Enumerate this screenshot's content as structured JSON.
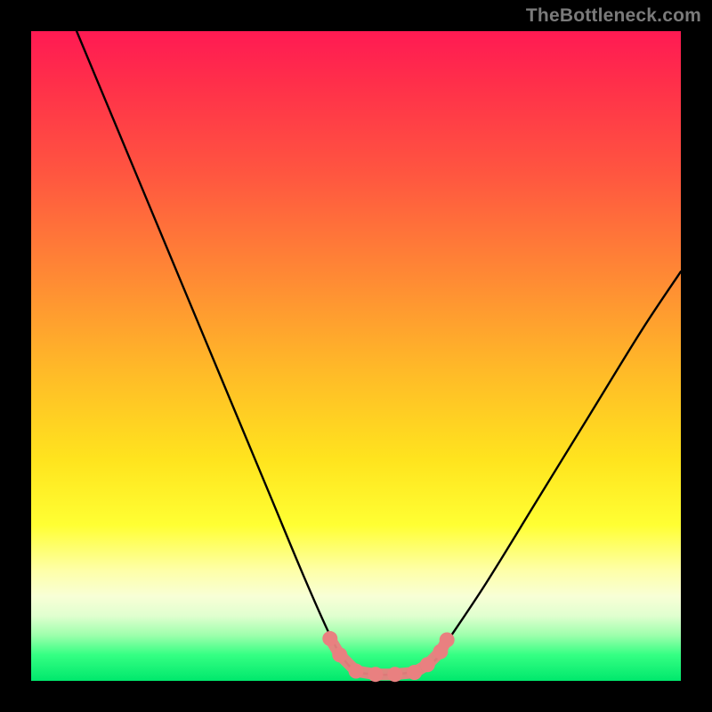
{
  "watermark": "TheBottleneck.com",
  "chart_data": {
    "type": "line",
    "title": "",
    "xlabel": "",
    "ylabel": "",
    "xlim": [
      0,
      100
    ],
    "ylim": [
      0,
      100
    ],
    "grid": false,
    "legend": false,
    "series": [
      {
        "name": "bottleneck-curve",
        "color": "#000000",
        "x": [
          7,
          12,
          17,
          22,
          27,
          32,
          37,
          42,
          46,
          48,
          50,
          53,
          56,
          59,
          62,
          64,
          70,
          78,
          86,
          94,
          100
        ],
        "y": [
          100,
          88,
          76,
          64,
          52,
          40,
          28,
          16,
          7,
          3.5,
          1.5,
          1,
          1,
          1.5,
          3,
          6,
          15,
          28,
          41,
          54,
          63
        ]
      },
      {
        "name": "highlight-dots",
        "color": "#e98080",
        "type": "scatter",
        "x": [
          46,
          47.5,
          50,
          53,
          56,
          59,
          61,
          63,
          64
        ],
        "y": [
          6.5,
          4,
          1.5,
          1,
          1,
          1.3,
          2.5,
          4.5,
          6.3
        ]
      }
    ]
  }
}
